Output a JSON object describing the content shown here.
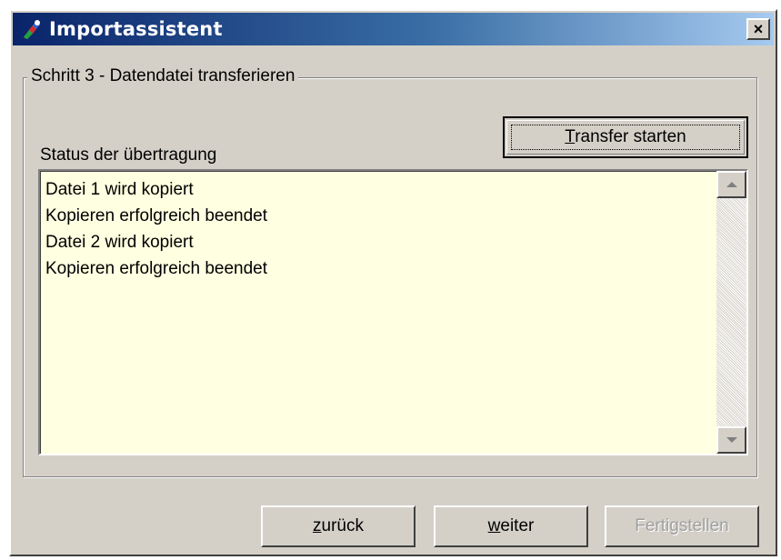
{
  "window": {
    "title": "Importassistent",
    "close_label": "×"
  },
  "step": {
    "group_title": "Schritt 3 - Datendatei transferieren",
    "status_label": "Status der übertragung",
    "transfer_button": {
      "accel": "T",
      "rest": "ransfer starten"
    },
    "log_lines": [
      "Datei 1 wird kopiert",
      "Kopieren erfolgreich beendet",
      "Datei 2 wird kopiert",
      "Kopieren erfolgreich beendet"
    ]
  },
  "buttons": {
    "back": {
      "accel": "z",
      "rest": "urück"
    },
    "next": {
      "accel": "w",
      "rest": "eiter"
    },
    "finish": {
      "label": "Fertigstellen",
      "enabled": false
    }
  },
  "colors": {
    "listbox_background": "#ffffe1",
    "title_gradient_start": "#0a246a",
    "title_gradient_end": "#a6caf0"
  },
  "icons": {
    "app": "wizard-app-icon",
    "close": "close-icon",
    "scroll_up": "scroll-up-arrow-icon",
    "scroll_down": "scroll-down-arrow-icon"
  }
}
